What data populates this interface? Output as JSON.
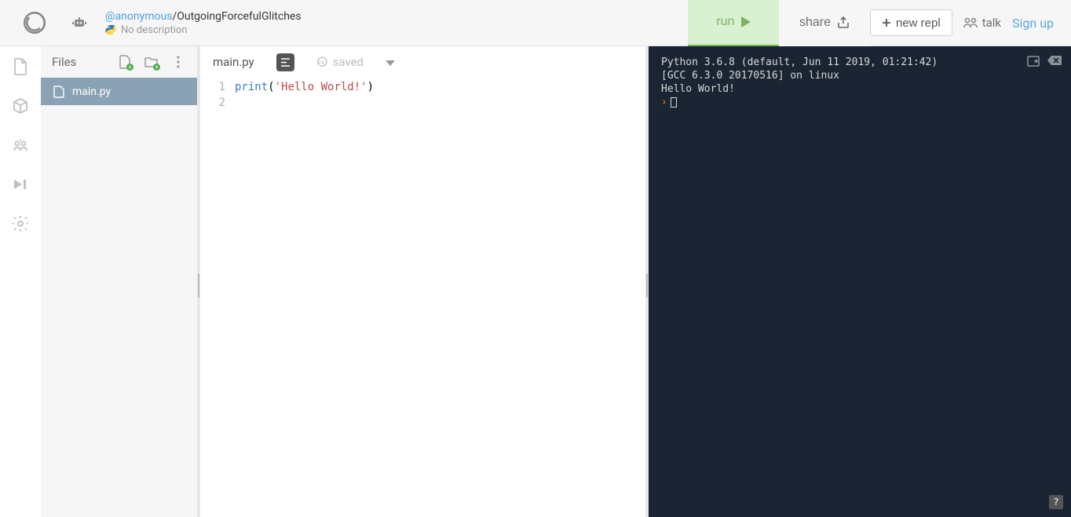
{
  "header": {
    "user": "@anonymous",
    "project": "/OutgoingForcefulGlitches",
    "description": "No description",
    "run_label": "run",
    "share_label": "share",
    "new_repl_label": "new repl",
    "talk_label": "talk",
    "signup_label": "Sign up"
  },
  "files": {
    "panel_title": "Files",
    "items": [
      "main.py"
    ],
    "active": "main.py"
  },
  "editor": {
    "tab": "main.py",
    "saved_label": "saved",
    "line_numbers": [
      "1",
      "2"
    ],
    "code": {
      "fn": "print",
      "open": "(",
      "str": "'Hello World!'",
      "close": ")"
    }
  },
  "terminal": {
    "lines": [
      "Python 3.6.8 (default, Jun 11 2019, 01:21:42)",
      "[GCC 6.3.0 20170516] on linux",
      "Hello World!"
    ],
    "prompt": ""
  },
  "help": "?"
}
